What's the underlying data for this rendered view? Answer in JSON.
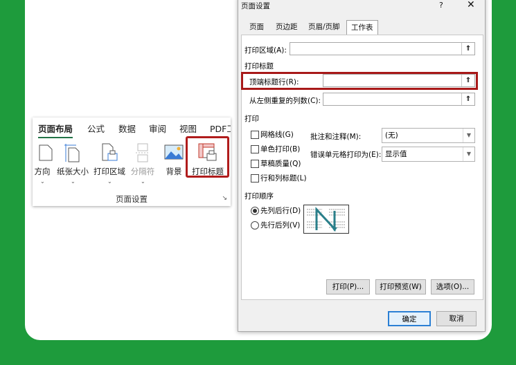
{
  "ribbon": {
    "tabs": [
      "页面布局",
      "公式",
      "数据",
      "审阅",
      "视图",
      "PDF工"
    ],
    "buttons": [
      {
        "label": "方向"
      },
      {
        "label": "纸张大小"
      },
      {
        "label": "打印区域"
      },
      {
        "label": "分隔符"
      },
      {
        "label": "背景"
      },
      {
        "label": "打印标题"
      }
    ],
    "group_label": "页面设置",
    "launcher": "↘"
  },
  "dialog": {
    "title": "页面设置",
    "help": "?",
    "close": "✕",
    "tabs": [
      "页面",
      "页边距",
      "页眉/页脚",
      "工作表"
    ],
    "print_area_label": "打印区域(A):",
    "print_area_value": "",
    "print_titles_section": "打印标题",
    "rows_to_repeat_label": "顶端标题行(R):",
    "rows_to_repeat_value": "",
    "cols_to_repeat_label": "从左侧重复的列数(C):",
    "cols_to_repeat_value": "",
    "picker_glyph": "⇑",
    "print_section": "打印",
    "checkboxes": [
      {
        "label": "网格线(G)",
        "checked": false
      },
      {
        "label": "单色打印(B)",
        "checked": false
      },
      {
        "label": "草稿质量(Q)",
        "checked": false
      },
      {
        "label": "行和列标题(L)",
        "checked": false
      }
    ],
    "comments_label": "批注和注释(M):",
    "comments_value": "(无)",
    "errors_label": "错误单元格打印为(E):",
    "errors_value": "显示值",
    "page_order_section": "打印顺序",
    "radios": [
      {
        "label": "先列后行(D)",
        "selected": true
      },
      {
        "label": "先行后列(V)",
        "selected": false
      }
    ],
    "buttons": {
      "print": "打印(P)...",
      "preview": "打印预览(W)",
      "options": "选项(O)..."
    },
    "ok": "确定",
    "cancel": "取消"
  },
  "colors": {
    "background": "#1e9b3c",
    "highlight": "#b01c1c",
    "accent": "#217346"
  }
}
